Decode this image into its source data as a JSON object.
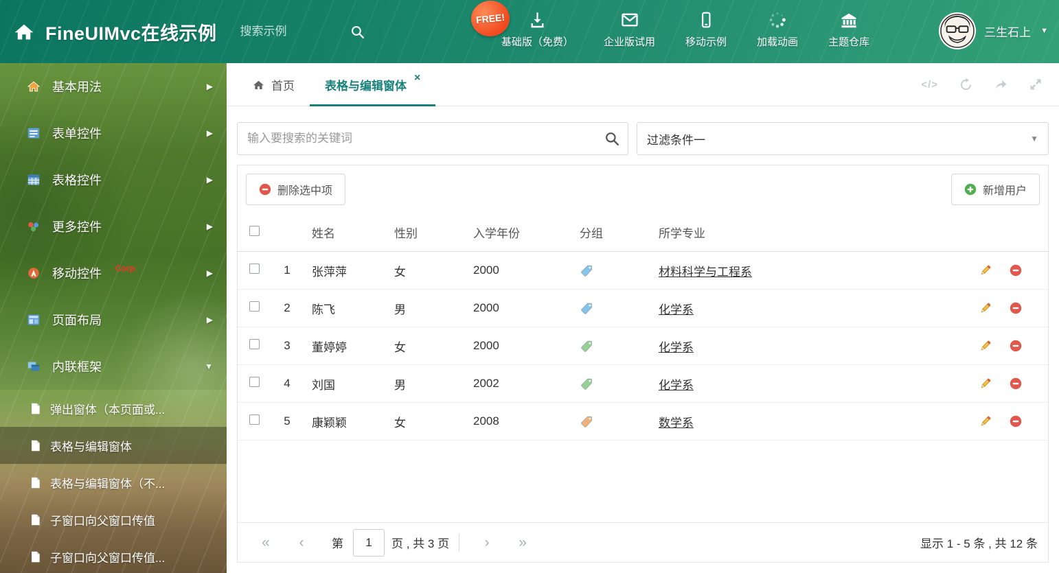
{
  "icons": {
    "code": "</>",
    "caret_down": "▼",
    "arrow_right": "▶",
    "close": "×",
    "pager_first": "«",
    "pager_prev": "‹",
    "pager_next": "›",
    "pager_last": "»"
  },
  "header": {
    "title": "FineUIMvc在线示例",
    "search_placeholder": "搜索示例",
    "free_badge": "FREE!",
    "nav_items": [
      {
        "label": "基础版（免费）"
      },
      {
        "label": "企业版试用"
      },
      {
        "label": "移动示例"
      },
      {
        "label": "加载动画"
      },
      {
        "label": "主题仓库"
      }
    ],
    "user_name": "三生石上"
  },
  "sidebar": {
    "items": [
      {
        "label": "基本用法"
      },
      {
        "label": "表单控件"
      },
      {
        "label": "表格控件"
      },
      {
        "label": "更多控件"
      },
      {
        "label": "移动控件",
        "badge": "Corp."
      },
      {
        "label": "页面布局"
      },
      {
        "label": "内联框架"
      }
    ],
    "subitems": [
      {
        "label": "弹出窗体（本页面或..."
      },
      {
        "label": "表格与编辑窗体"
      },
      {
        "label": "表格与编辑窗体（不..."
      },
      {
        "label": "子窗口向父窗口传值"
      },
      {
        "label": "子窗口向父窗口传值..."
      }
    ]
  },
  "tabs": {
    "home_label": "首页",
    "active_label": "表格与编辑窗体"
  },
  "filters": {
    "search_placeholder": "输入要搜索的关键词",
    "filter_value": "过滤条件一"
  },
  "toolbar": {
    "delete_label": "删除选中项",
    "add_label": "新增用户"
  },
  "table": {
    "headers": [
      "姓名",
      "性别",
      "入学年份",
      "分组",
      "所学专业"
    ],
    "rows": [
      {
        "num": "1",
        "name": "张萍萍",
        "gender": "女",
        "year": "2000",
        "tag_color": "#85c4ea",
        "major": "材料科学与工程系"
      },
      {
        "num": "2",
        "name": "陈飞",
        "gender": "男",
        "year": "2000",
        "tag_color": "#85c4ea",
        "major": "化学系"
      },
      {
        "num": "3",
        "name": "董婷婷",
        "gender": "女",
        "year": "2000",
        "tag_color": "#96d096",
        "major": "化学系"
      },
      {
        "num": "4",
        "name": "刘国",
        "gender": "男",
        "year": "2002",
        "tag_color": "#96d096",
        "major": "化学系"
      },
      {
        "num": "5",
        "name": "康颖颖",
        "gender": "女",
        "year": "2008",
        "tag_color": "#f2b077",
        "major": "数学系"
      }
    ]
  },
  "pagination": {
    "label_page": "第",
    "current_page": "1",
    "label_total": "页 , 共 3 页",
    "summary": "显示 1 - 5 条 , 共 12 条"
  },
  "colors": {
    "accent": "#17827b",
    "danger": "#e2574c",
    "success": "#4fae4f"
  }
}
